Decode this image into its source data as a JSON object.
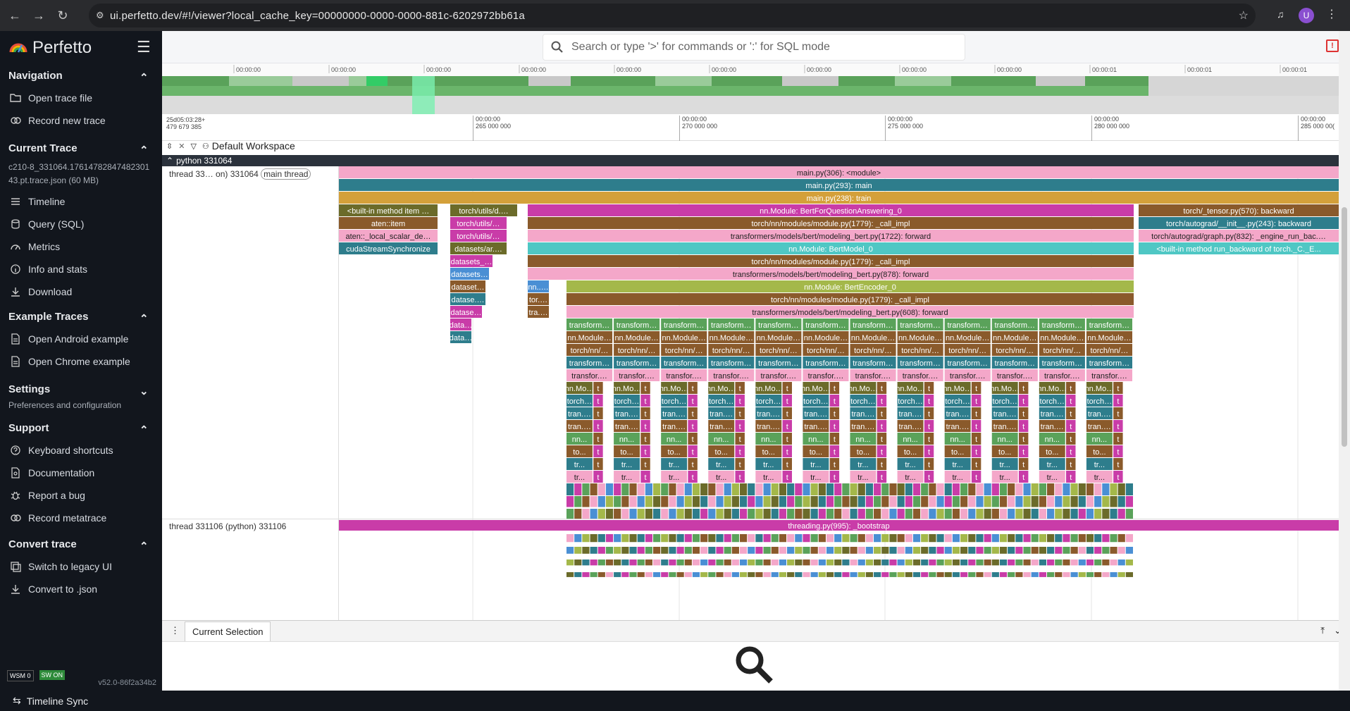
{
  "browser": {
    "url": "ui.perfetto.dev/#!/viewer?local_cache_key=00000000-0000-0000-881c-6202972bb61a",
    "profile_initial": "U"
  },
  "app": {
    "name": "Perfetto",
    "version": "v52.0-86f2a34b2"
  },
  "sidebar": {
    "navigation": {
      "title": "Navigation",
      "items": [
        "Open trace file",
        "Record new trace"
      ]
    },
    "current_trace": {
      "title": "Current Trace",
      "trace_name": "c210-8_331064.17614782847482301 43.pt.trace.json (60 MB)",
      "items": [
        "Timeline",
        "Query (SQL)",
        "Metrics",
        "Info and stats",
        "Download"
      ]
    },
    "example_traces": {
      "title": "Example Traces",
      "items": [
        "Open Android example",
        "Open Chrome example"
      ]
    },
    "settings": {
      "title": "Settings",
      "subtitle": "Preferences and configuration"
    },
    "support": {
      "title": "Support",
      "items": [
        "Keyboard shortcuts",
        "Documentation",
        "Report a bug",
        "Record metatrace"
      ]
    },
    "convert": {
      "title": "Convert trace",
      "items": [
        "Switch to legacy UI",
        "Convert to .json"
      ]
    },
    "badges": {
      "wsm": "WSM 0",
      "sw": "SW ON"
    }
  },
  "search": {
    "placeholder": "Search or type '>' for commands or ':' for SQL mode"
  },
  "overview": {
    "ticks": [
      "00:00:00",
      "00:00:00",
      "00:00:00",
      "00:00:00",
      "00:00:00",
      "00:00:00",
      "00:00:00",
      "00:00:00",
      "00:00:00",
      "00:00:01",
      "00:00:01",
      "00:00:01"
    ]
  },
  "ruler": {
    "origin_line1": "25d05:03:28+",
    "origin_line2": "479 679 385",
    "ticks": [
      {
        "t": "00:00:00",
        "v": "265 000 000"
      },
      {
        "t": "00:00:00",
        "v": "270 000 000"
      },
      {
        "t": "00:00:00",
        "v": "275 000 000"
      },
      {
        "t": "00:00:00",
        "v": "280 000 000"
      },
      {
        "t": "00:00:00",
        "v": "285 000 00("
      }
    ]
  },
  "workspace": {
    "label": "Default Workspace"
  },
  "process": {
    "label": "python 331064"
  },
  "threads": {
    "main": "thread 33… on) 331064",
    "main_pill": "main thread",
    "other": "thread 331106 (python) 331106"
  },
  "slices": {
    "main_rows": [
      "main.py(306): <module>",
      "main.py(293): main",
      "main.py(238): train"
    ],
    "left_col": [
      "<built-in method item ...",
      "aten::item",
      "aten::_local_scalar_de...",
      "cudaStreamSynchronize"
    ],
    "utils_col": [
      "torch/utils/d...",
      "torch/utils/d...",
      "torch/utils/d...",
      "datasets/ar...",
      "datasets_...",
      "datasets_...",
      "dataset...",
      "datase...",
      "datase...",
      "data...",
      "data..."
    ],
    "forward_rows": [
      "nn.Module: BertForQuestionAnswering_0",
      "torch/nn/modules/module.py(1779): _call_impl",
      "transformers/models/bert/modeling_bert.py(1722): forward",
      "nn.Module: BertModel_0",
      "torch/nn/modules/module.py(1779): _call_impl",
      "transformers/models/bert/modeling_bert.py(878): forward",
      "nn.Module: BertEncoder_0",
      "torch/nn/modules/module.py(1779): _call_impl",
      "transformers/models/bert/modeling_bert.py(608): forward"
    ],
    "backward_rows": [
      "torch/_tensor.py(570): backward",
      "torch/autograd/__init__.py(243): backward",
      "torch/autograd/graph.py(832): _engine_run_bac...",
      "<built-in method run_backward of torch._C._E..."
    ],
    "layer_labels": [
      "transform...",
      "nn.Module...",
      "torch/nn/...",
      "transform...",
      "transfor..."
    ],
    "small_labels": [
      "nn.Mo...",
      "torch...",
      "tran...",
      "tran...",
      "nn...",
      "to...",
      "tr...",
      "tr..."
    ],
    "bootstrap": "threading.py(995): _bootstrap",
    "mini": [
      "nn....",
      "tor...",
      "tra...",
      "t",
      "d",
      "n"
    ]
  },
  "bottom_panel": {
    "tab": "Current Selection"
  },
  "status_bar": {
    "label": "Timeline Sync"
  },
  "colors": {
    "pink": "#f4a7c9",
    "teal": "#2e7d8c",
    "gold": "#d4a03a",
    "olive": "#6b6b2a",
    "green": "#5aa25a",
    "magenta": "#c93ca8",
    "cyan": "#4fc7c4",
    "brown": "#8a5a2b",
    "lime": "#a4b84a",
    "blue": "#4a8fd4"
  }
}
